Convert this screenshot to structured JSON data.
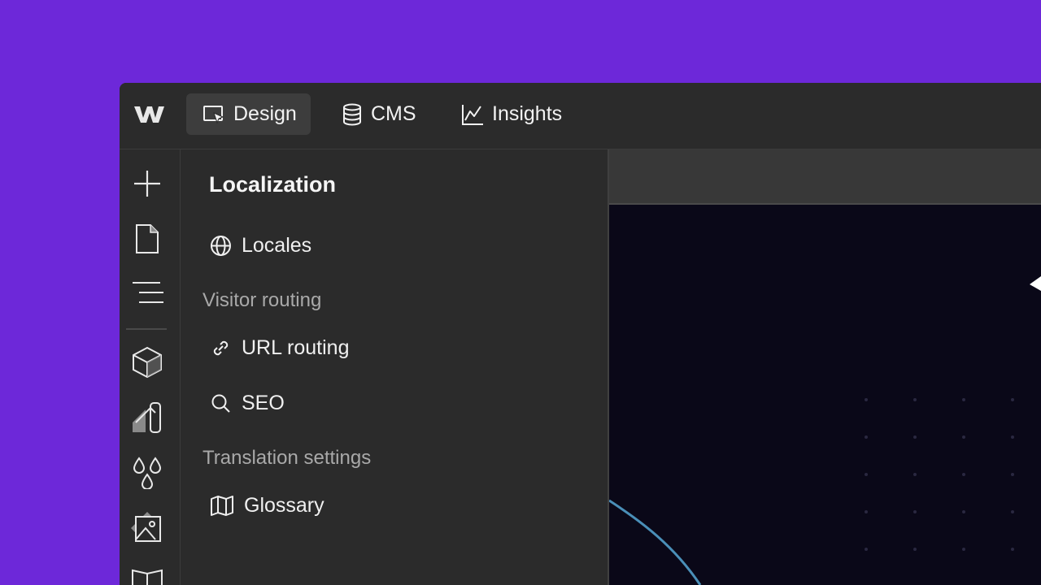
{
  "topbar": {
    "tabs": [
      {
        "label": "Design",
        "icon": "design-cursor-icon",
        "active": true
      },
      {
        "label": "CMS",
        "icon": "database-icon",
        "active": false
      },
      {
        "label": "Insights",
        "icon": "chart-line-icon",
        "active": false
      }
    ]
  },
  "rail": {
    "icons": [
      "add-icon",
      "page-icon",
      "navigator-icon",
      "components-icon",
      "style-selector-icon",
      "variables-icon",
      "assets-icon",
      "library-icon"
    ]
  },
  "panel": {
    "title": "Localization",
    "locales_label": "Locales",
    "visitor_routing_heading": "Visitor routing",
    "url_routing_label": "URL routing",
    "seo_label": "SEO",
    "translation_settings_heading": "Translation settings",
    "glossary_label": "Glossary"
  },
  "colors": {
    "background": "#6d28d9",
    "app_bg": "#2b2b2b",
    "active_tab": "#3d3d3d",
    "canvas": "#0a0818",
    "arc": "#4a8fb8"
  }
}
